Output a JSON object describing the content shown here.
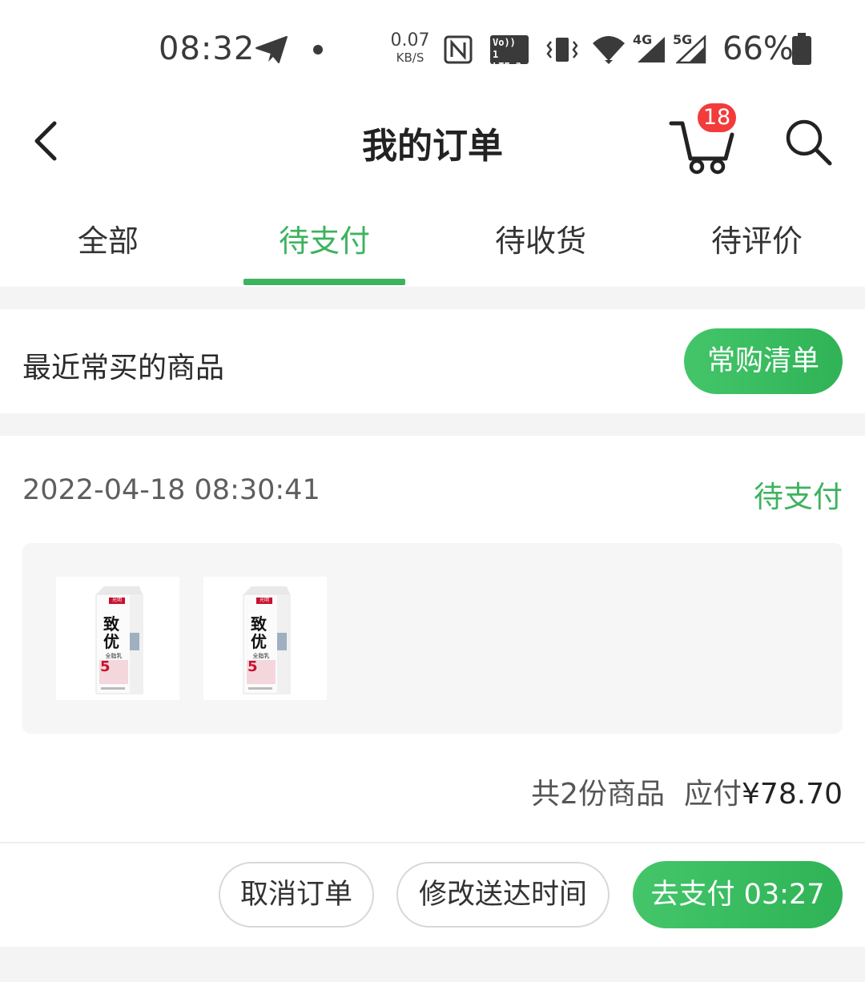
{
  "status_bar": {
    "time": "08:32",
    "net_speed_value": "0.07",
    "net_speed_unit": "KB/S",
    "volte_line1": "Vo))",
    "volte_line2": "LTE",
    "sim1": "1",
    "sim2": "2",
    "net_4g": "4G",
    "net_5g": "5G",
    "battery": "66%"
  },
  "header": {
    "title": "我的订单",
    "cart_badge": "18"
  },
  "tabs": [
    {
      "label": "全部",
      "active": false
    },
    {
      "label": "待支付",
      "active": true
    },
    {
      "label": "待收货",
      "active": false
    },
    {
      "label": "待评价",
      "active": false
    }
  ],
  "frequent": {
    "title": "最近常买的商品",
    "button": "常购清单"
  },
  "order": {
    "datetime": "2022-04-18 08:30:41",
    "status": "待支付",
    "products": [
      {
        "brand": "光明",
        "name": "致优",
        "subtitle": "全脂乳",
        "badge": "5"
      },
      {
        "brand": "光明",
        "name": "致优",
        "subtitle": "全脂乳",
        "badge": "5"
      }
    ],
    "item_count": "共2份商品",
    "payable_label": "应付",
    "payable_amount": "¥78.70",
    "cancel_button": "取消订单",
    "modify_button": "修改送达时间",
    "pay_button": "去支付 03:27"
  },
  "colors": {
    "accent_green": "#3db35e",
    "badge_red": "#f23b3b"
  }
}
